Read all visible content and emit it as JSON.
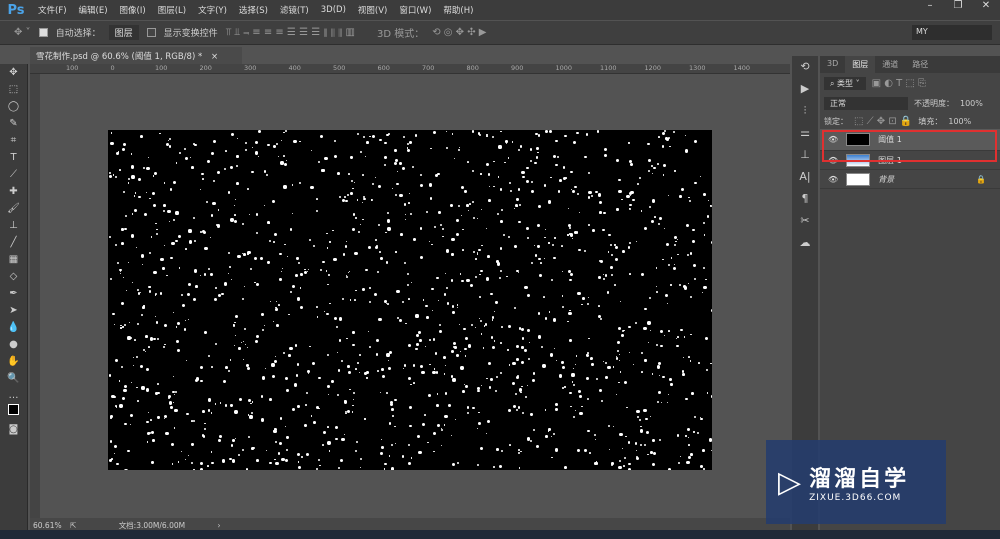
{
  "app": {
    "logo": "Ps",
    "menus": [
      "文件(F)",
      "编辑(E)",
      "图像(I)",
      "图层(L)",
      "文字(Y)",
      "选择(S)",
      "滤镜(T)",
      "3D(D)",
      "视图(V)",
      "窗口(W)",
      "帮助(H)"
    ]
  },
  "options": {
    "auto_select_label": "自动选择：",
    "auto_select_checked": true,
    "auto_select_value": "图层",
    "show_transform_label": "显示变换控件",
    "show_transform_checked": false,
    "mode_3d_label": "3D 模式：",
    "workspace": "MY"
  },
  "document": {
    "tab_title": "雪花制作.psd @ 60.6% (阈值 1, RGB/8) *",
    "close": "×",
    "ruler_ticks": [
      "100",
      "0",
      "100",
      "200",
      "300",
      "400",
      "500",
      "600",
      "700",
      "800",
      "900",
      "1000",
      "1100",
      "1200",
      "1300",
      "1400"
    ]
  },
  "status": {
    "zoom": "60.61%",
    "doc_size": "文档:3.00M/6.00M"
  },
  "panel": {
    "tabs": [
      "3D",
      "图层",
      "通道",
      "路径"
    ],
    "active_tab": "图层",
    "filter": "类型",
    "blend_mode": "正常",
    "opacity_label": "不透明度：",
    "opacity": "100%",
    "lock_label": "锁定：",
    "fill_label": "填充：",
    "fill": "100%",
    "layers": [
      {
        "name": "阈值 1",
        "selected": true
      },
      {
        "name": "图层 1",
        "selected": false
      },
      {
        "name": "背景",
        "selected": false,
        "locked": true
      }
    ]
  },
  "watermark": {
    "brand": "溜溜自学",
    "url": "ZIXUE.3D66.COM"
  }
}
